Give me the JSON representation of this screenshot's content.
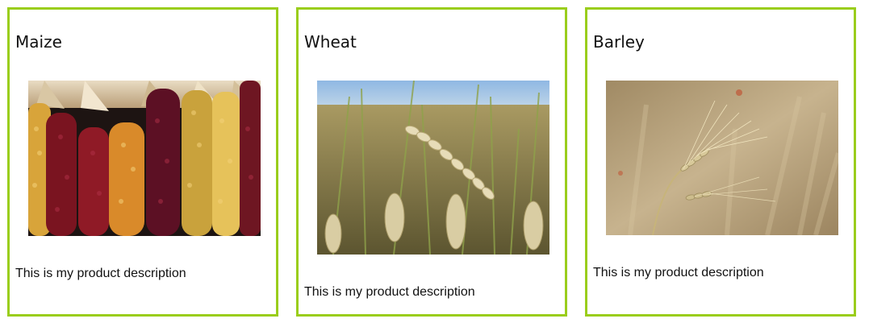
{
  "colors": {
    "card_border": "#9acd1c"
  },
  "products": [
    {
      "title": "Maize",
      "description": "This is my product description",
      "image": "maize-photo"
    },
    {
      "title": "Wheat",
      "description": "This is my product description",
      "image": "wheat-photo"
    },
    {
      "title": "Barley",
      "description": "This is my product description",
      "image": "barley-photo"
    }
  ]
}
